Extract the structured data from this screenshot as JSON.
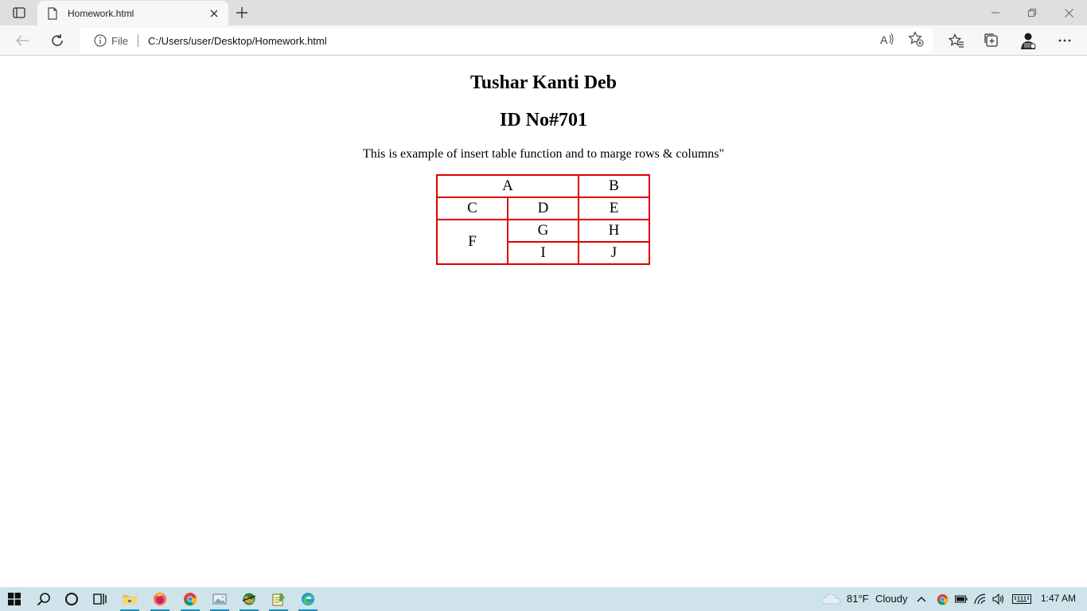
{
  "browser": {
    "tab": {
      "title": "Homework.html",
      "favicon": "page-icon",
      "close_icon": "close-icon"
    },
    "new_tab_icon": "plus-icon",
    "window_controls": [
      "minimize-icon",
      "restore-icon",
      "close-icon"
    ],
    "toolbar": {
      "back_icon": "back-arrow-icon",
      "refresh_icon": "refresh-icon",
      "address": {
        "info_icon": "info-icon",
        "scheme": "File",
        "url": "C:/Users/user/Desktop/Homework.html"
      },
      "right_icons": [
        "read-aloud-icon",
        "add-favorite-icon",
        "favorites-icon",
        "collections-icon",
        "profile-avatar",
        "more-icon"
      ]
    }
  },
  "page": {
    "heading_name": "Tushar Kanti Deb",
    "heading_id": "ID No#701",
    "description": "This is example of insert table function and to marge rows & columns\"",
    "table": {
      "border_color": "#e00000",
      "cells": {
        "a": "A",
        "b": "B",
        "c": "C",
        "d": "D",
        "e": "E",
        "f": "F",
        "g": "G",
        "h": "H",
        "i": "I",
        "j": "J"
      }
    }
  },
  "taskbar": {
    "pinned": [
      "windows-start-icon",
      "search-icon",
      "cortana-icon",
      "task-view-icon",
      "file-explorer-icon",
      "firefox-icon",
      "chrome-icon",
      "photo-viewer-icon",
      "globe-app-icon",
      "notepad-icon",
      "edge-icon"
    ],
    "weather": {
      "icon": "cloud-icon",
      "temperature": "81°F",
      "condition": "Cloudy"
    },
    "tray": [
      "chevron-up-icon",
      "chrome-tray-icon",
      "battery-icon",
      "wifi-icon",
      "volume-icon",
      "keyboard-icon"
    ],
    "time": "1:47 AM"
  }
}
